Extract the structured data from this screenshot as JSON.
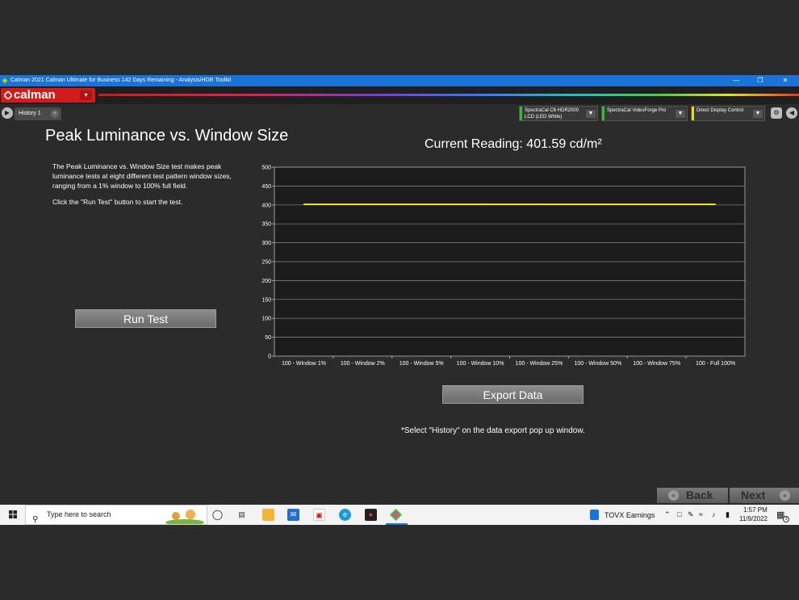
{
  "window": {
    "title": "Calman 2021 Calman Ultimate for Business 142 Days Remaining  - Analysis/HDR Toolkit",
    "minimize": "—",
    "restore": "❐",
    "close": "✕"
  },
  "logo": {
    "text": "calman",
    "dropdown": "▾"
  },
  "tabs": [
    {
      "label": "History 1",
      "add": "+"
    }
  ],
  "devices": [
    {
      "line1": "SpectraCal C6 HDR2000",
      "line2": "LCD (LED White)",
      "accent": "#2fbf2f"
    },
    {
      "line1": "SpectraCal VideoForge Pro",
      "line2": "",
      "accent": "#2fbf2f"
    },
    {
      "line1": "Direct Display Control",
      "line2": "",
      "accent": "#e6d81f"
    }
  ],
  "main": {
    "title": "Peak Luminance vs. Window Size",
    "description": "The Peak Luminance vs. Window Size test makes peak luminance tests at eight different test pattern window sizes, ranging from a 1% window to 100% full field.",
    "instruction": "Click the \"Run Test\" button to start the test.",
    "run_test_label": "Run Test",
    "current_reading": "Current Reading: 401.59 cd/m²",
    "export_label": "Export  Data",
    "export_note": "*Select \"History\" on the data export pop up window."
  },
  "chart_data": {
    "type": "line",
    "categories": [
      "100 - Window  1%",
      "100 - Window  2%",
      "100 - Window  5%",
      "100 - Window 10%",
      "100 - Window 25%",
      "100 - Window 50%",
      "100 - Window 75%",
      "100 - Full  100%"
    ],
    "series": [
      {
        "values": [
          401.59,
          401.59,
          401.59,
          401.59,
          401.59,
          401.59,
          401.59,
          401.59
        ],
        "color": "#e8e020"
      }
    ],
    "ylim": [
      0,
      500
    ],
    "yticks": [
      0,
      50,
      100,
      150,
      200,
      250,
      300,
      350,
      400,
      450,
      500
    ],
    "grid": true
  },
  "nav": {
    "back_label": "Back",
    "next_label": "Next"
  },
  "taskbar": {
    "search_placeholder": "Type here to search",
    "stock_text": "TOVX  Earnings",
    "time": "1:57 PM",
    "date": "11/9/2022",
    "notification_count": "3"
  }
}
